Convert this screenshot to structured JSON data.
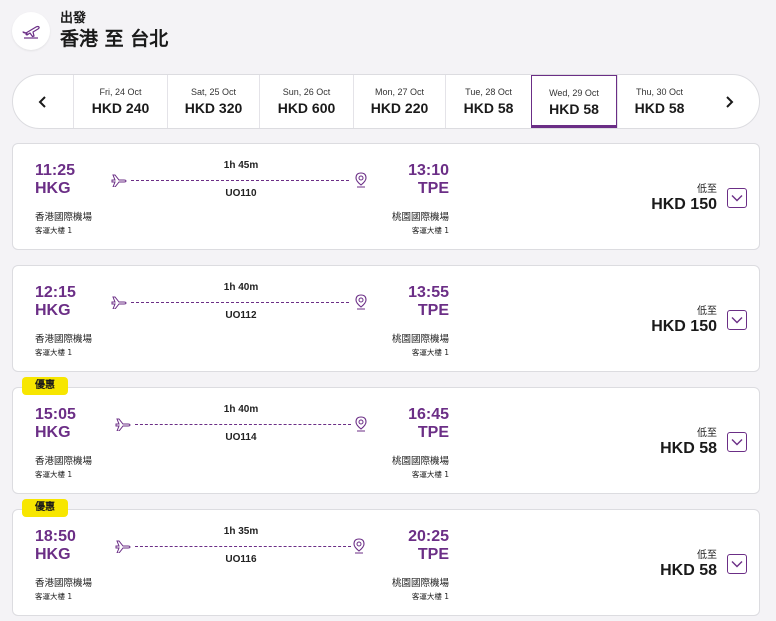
{
  "header": {
    "subtitle": "出發",
    "title": "香港 至 台北",
    "icon": "plane-departure-icon"
  },
  "date_bar": {
    "dates": [
      {
        "label": "Fri, 24 Oct",
        "price": "HKD 240",
        "selected": false
      },
      {
        "label": "Sat, 25 Oct",
        "price": "HKD 320",
        "selected": false
      },
      {
        "label": "Sun, 26 Oct",
        "price": "HKD 600",
        "selected": false
      },
      {
        "label": "Mon, 27 Oct",
        "price": "HKD 220",
        "selected": false
      },
      {
        "label": "Tue, 28 Oct",
        "price": "HKD 58",
        "selected": false
      },
      {
        "label": "Wed, 29 Oct",
        "price": "HKD 58",
        "selected": true
      },
      {
        "label": "Thu, 30 Oct",
        "price": "HKD 58",
        "selected": false
      }
    ]
  },
  "flights": [
    {
      "promo": "",
      "dep_time": "11:25",
      "dep_code": "HKG",
      "dep_airport": "香港國際機場",
      "dep_terminal": "客運大樓 1",
      "duration": "1h 45m",
      "flight_no": "UO110",
      "arr_time": "13:10",
      "arr_code": "TPE",
      "arr_airport": "桃園國際機場",
      "arr_terminal": "客運大樓 1",
      "price_label": "低至",
      "price": "HKD 150"
    },
    {
      "promo": "",
      "dep_time": "12:15",
      "dep_code": "HKG",
      "dep_airport": "香港國際機場",
      "dep_terminal": "客運大樓 1",
      "duration": "1h 40m",
      "flight_no": "UO112",
      "arr_time": "13:55",
      "arr_code": "TPE",
      "arr_airport": "桃園國際機場",
      "arr_terminal": "客運大樓 1",
      "price_label": "低至",
      "price": "HKD 150"
    },
    {
      "promo": "優惠",
      "dep_time": "15:05",
      "dep_code": "HKG",
      "dep_airport": "香港國際機場",
      "dep_terminal": "客運大樓 1",
      "duration": "1h 40m",
      "flight_no": "UO114",
      "arr_time": "16:45",
      "arr_code": "TPE",
      "arr_airport": "桃園國際機場",
      "arr_terminal": "客運大樓 1",
      "price_label": "低至",
      "price": "HKD 58"
    },
    {
      "promo": "優惠",
      "dep_time": "18:50",
      "dep_code": "HKG",
      "dep_airport": "香港國際機場",
      "dep_terminal": "客運大樓 1",
      "duration": "1h 35m",
      "flight_no": "UO116",
      "arr_time": "20:25",
      "arr_code": "TPE",
      "arr_airport": "桃園國際機場",
      "arr_terminal": "客運大樓 1",
      "price_label": "低至",
      "price": "HKD 58"
    }
  ],
  "colors": {
    "brand_purple": "#6b2e86",
    "promo_yellow": "#f7e600"
  }
}
